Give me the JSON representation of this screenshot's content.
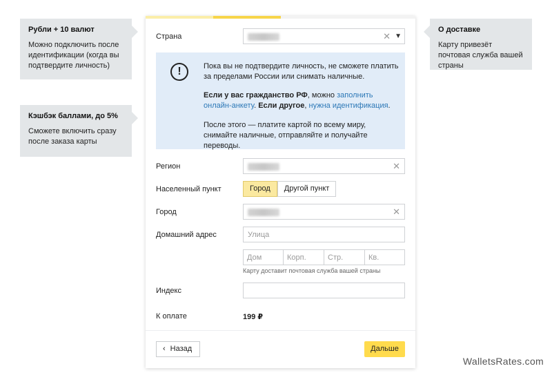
{
  "tips": {
    "rubles": {
      "title": "Рубли + 10 валют",
      "text": "Можно подключить после идентификации (когда вы подтвердите личность)"
    },
    "cashback": {
      "title": "Кэшбэк баллами, до 5%",
      "text": "Сможете включить сразу после заказа карты"
    },
    "delivery": {
      "title": "О доставке",
      "text": "Карту привезёт почтовая служба вашей страны"
    }
  },
  "progress": {
    "colors": [
      "#fbeea9",
      "#f7d54a",
      "#f3f3f3",
      "#f3f3f3"
    ]
  },
  "form": {
    "country_label": "Страна",
    "info": {
      "icon": "exclamation-icon",
      "p1": "Пока вы не подтвердите личность, не сможете платить за пределами России или снимать наличные.",
      "p2_bold1": "Если у вас гражданство РФ",
      "p2_text1": ", можно ",
      "p2_link1": "заполнить онлайн-анкету",
      "p2_text2": ". ",
      "p2_bold2": "Если другое",
      "p2_text3": ", ",
      "p2_link2": "нужна идентификация",
      "p2_text4": ".",
      "p3": "После этого — платите картой по всему миру, снимайте наличные, отправляйте и получайте переводы."
    },
    "region_label": "Регион",
    "locality_label": "Населенный пункт",
    "locality_options": [
      "Город",
      "Другой пункт"
    ],
    "city_label": "Город",
    "address_label": "Домашний адрес",
    "street_placeholder": "Улица",
    "house_placeholder": "Дом",
    "building_placeholder": "Корп.",
    "structure_placeholder": "Стр.",
    "apartment_placeholder": "Кв.",
    "delivery_hint": "Карту доставит почтовая служба вашей страны",
    "index_label": "Индекс",
    "payment_label": "К оплате",
    "payment_amount": "199 ₽"
  },
  "buttons": {
    "back": "Назад",
    "next": "Дальше"
  },
  "watermark": "WalletsRates.com"
}
